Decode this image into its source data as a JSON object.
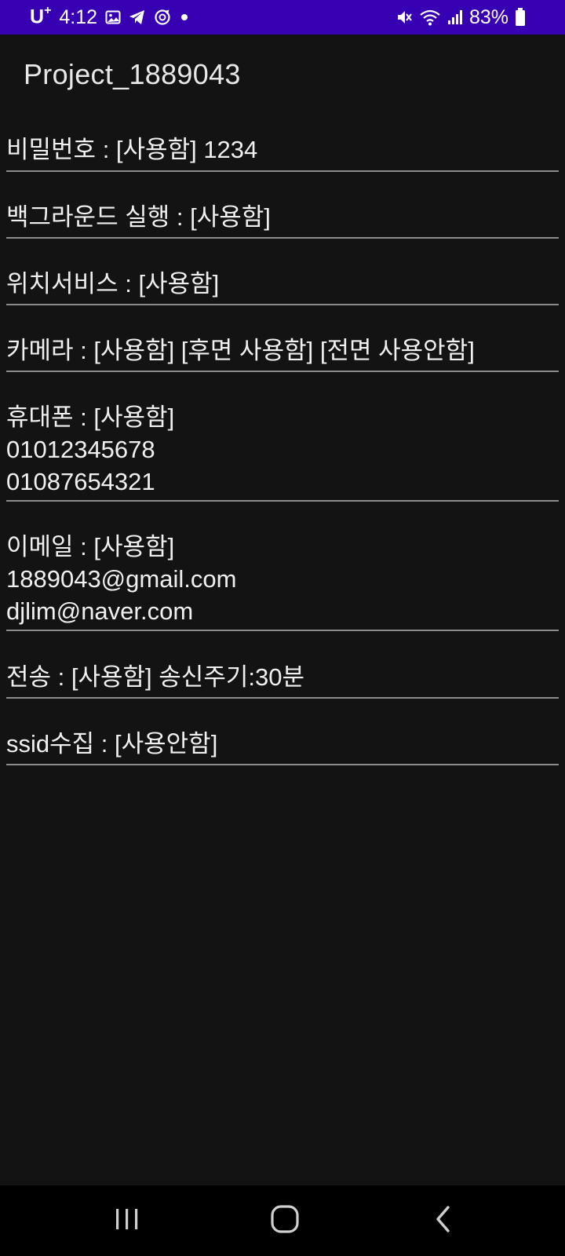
{
  "status_bar": {
    "carrier": "U",
    "carrier_sup": "+",
    "time": "4:12",
    "battery": "83%",
    "icons_left": [
      "gallery-icon",
      "telegram-icon",
      "sync-icon",
      "dot-icon"
    ],
    "icons_right": [
      "mute-icon",
      "wifi-icon",
      "signal-icon",
      "battery-icon"
    ]
  },
  "app": {
    "title": "Project_1889043"
  },
  "settings": [
    {
      "lines": [
        "비밀번호 : [사용함] 1234"
      ]
    },
    {
      "lines": [
        "백그라운드 실행 : [사용함]"
      ]
    },
    {
      "lines": [
        "위치서비스 : [사용함]"
      ]
    },
    {
      "lines": [
        "카메라 : [사용함] [후면 사용함] [전면 사용안함]"
      ]
    },
    {
      "lines": [
        "휴대폰 : [사용함]",
        "01012345678",
        "01087654321"
      ]
    },
    {
      "lines": [
        "이메일 : [사용함]",
        "1889043@gmail.com",
        "djlim@naver.com"
      ]
    },
    {
      "lines": [
        "전송 : [사용함] 송신주기:30분"
      ]
    },
    {
      "lines": [
        "ssid수집 : [사용안함]"
      ]
    }
  ],
  "nav": {
    "buttons": [
      "recents-icon",
      "home-icon",
      "back-icon"
    ]
  },
  "colors": {
    "status_bar": "#3700b3",
    "background": "#131313",
    "divider": "#8c8c8c",
    "nav_bar": "#000000"
  }
}
